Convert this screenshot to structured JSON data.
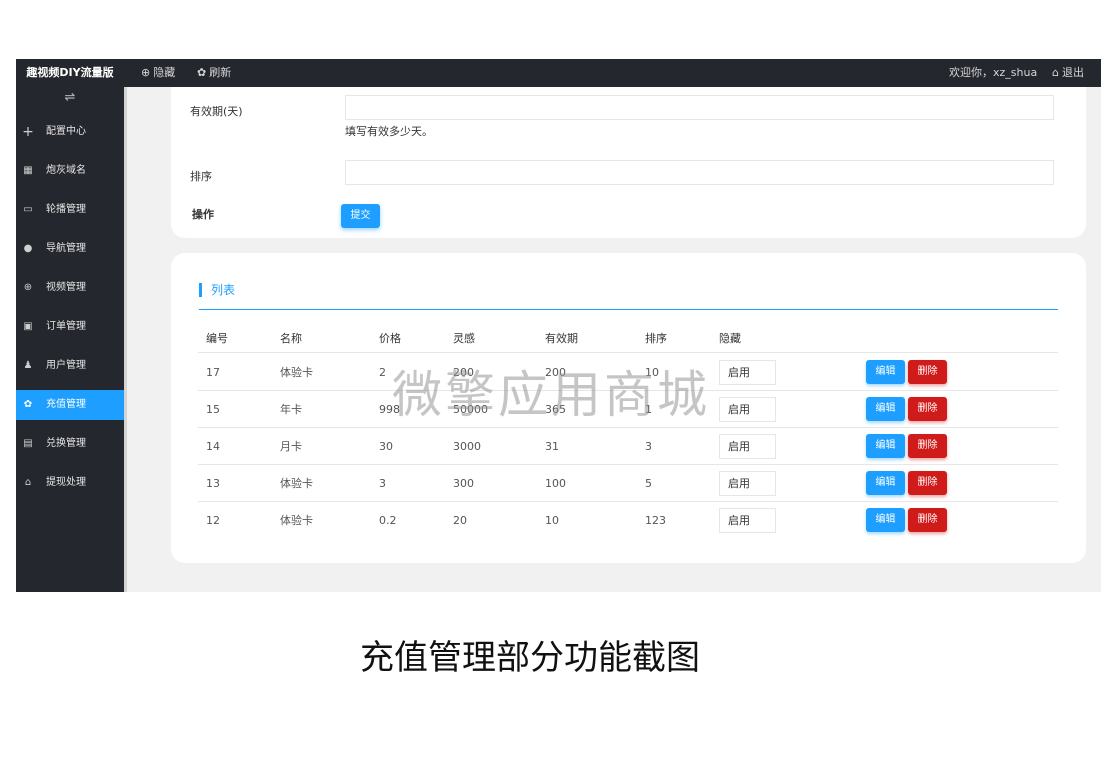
{
  "topbar": {
    "brand": "趣视频DIY流量版",
    "hide_label": "隐藏",
    "refresh_label": "刷新",
    "welcome": "欢迎你，xz_shua",
    "logout_label": "退出"
  },
  "sidebar": {
    "toggle_glyph": "⇌",
    "items": [
      {
        "label": "配置中心",
        "icon": "plus-icon"
      },
      {
        "label": "炮灰域名",
        "icon": "grid-icon"
      },
      {
        "label": "轮播管理",
        "icon": "card-icon"
      },
      {
        "label": "导航管理",
        "icon": "user-icon"
      },
      {
        "label": "视频管理",
        "icon": "globe-icon"
      },
      {
        "label": "订单管理",
        "icon": "ticket-icon"
      },
      {
        "label": "用户管理",
        "icon": "users-icon"
      },
      {
        "label": "充值管理",
        "icon": "gear-icon",
        "active": true
      },
      {
        "label": "兑换管理",
        "icon": "wallet-icon"
      },
      {
        "label": "提现处理",
        "icon": "home-icon"
      }
    ]
  },
  "form": {
    "validity_label": "有效期(天)",
    "validity_value": "",
    "validity_hint": "填写有效多少天。",
    "sort_label": "排序",
    "sort_value": "",
    "action_label": "操作",
    "submit_label": "提交"
  },
  "list": {
    "title": "列表",
    "columns": [
      "编号",
      "名称",
      "价格",
      "灵感",
      "有效期",
      "排序",
      "隐藏"
    ],
    "rows": [
      {
        "id": "17",
        "name": "体验卡",
        "price": "2",
        "inspiration": "200",
        "validity": "200",
        "sort": "10",
        "hidden": "启用"
      },
      {
        "id": "15",
        "name": "年卡",
        "price": "998",
        "inspiration": "50000",
        "validity": "365",
        "sort": "1",
        "hidden": "启用"
      },
      {
        "id": "14",
        "name": "月卡",
        "price": "30",
        "inspiration": "3000",
        "validity": "31",
        "sort": "3",
        "hidden": "启用"
      },
      {
        "id": "13",
        "name": "体验卡",
        "price": "3",
        "inspiration": "300",
        "validity": "100",
        "sort": "5",
        "hidden": "启用"
      },
      {
        "id": "12",
        "name": "体验卡",
        "price": "0.2",
        "inspiration": "20",
        "validity": "10",
        "sort": "123",
        "hidden": "启用"
      }
    ],
    "edit_label": "编辑",
    "delete_label": "删除"
  },
  "watermark": "微擎应用商城",
  "caption": "充值管理部分功能截图",
  "colors": {
    "accent": "#1e9fff",
    "danger": "#d01b1b",
    "dark": "#25272e"
  }
}
